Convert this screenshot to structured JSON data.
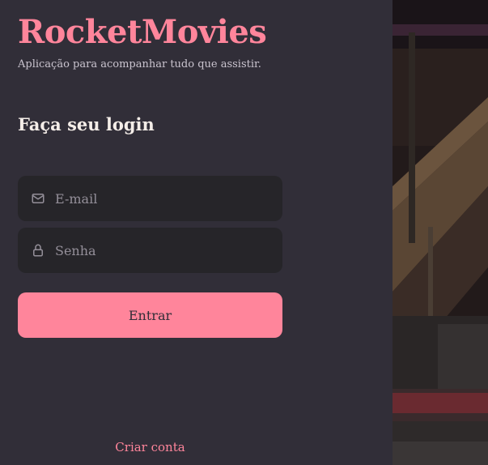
{
  "brand": {
    "title": "RocketMovies",
    "tagline": "Aplicação para acompanhar tudo que assistir."
  },
  "login": {
    "heading": "Faça seu login",
    "email_placeholder": "E-mail",
    "password_placeholder": "Senha",
    "submit_label": "Entrar",
    "create_account_label": "Criar conta"
  },
  "icons": {
    "email": "mail-icon",
    "password": "lock-icon"
  },
  "colors": {
    "background": "#312E38",
    "accent": "#FF859B",
    "input_background": "#262529",
    "text": "#F4EDE8",
    "placeholder": "#948F99"
  }
}
